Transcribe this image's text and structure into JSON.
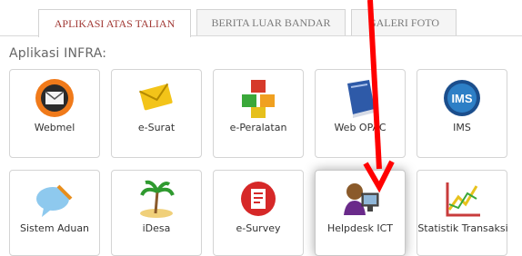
{
  "tabs": [
    {
      "label": "APLIKASI ATAS TALIAN",
      "active": true
    },
    {
      "label": "BERITA LUAR BANDAR",
      "active": false
    },
    {
      "label": "GALERI FOTO",
      "active": false
    }
  ],
  "section_title": "Aplikasi INFRA:",
  "apps": [
    {
      "label": "Webmel",
      "icon": "mail-envelope-icon"
    },
    {
      "label": "e-Surat",
      "icon": "envelope-icon"
    },
    {
      "label": "e-Peralatan",
      "icon": "boxes-icon"
    },
    {
      "label": "Web OPAC",
      "icon": "book-icon"
    },
    {
      "label": "IMS",
      "icon": "ims-globe-icon"
    },
    {
      "label": "Sistem Aduan",
      "icon": "speech-bubble-icon"
    },
    {
      "label": "iDesa",
      "icon": "palm-island-icon"
    },
    {
      "label": "e-Survey",
      "icon": "survey-icon"
    },
    {
      "label": "Helpdesk ICT",
      "icon": "helpdesk-icon"
    },
    {
      "label": "Statistik Transaksi",
      "icon": "chart-icon"
    }
  ],
  "accent_color": "#a23a36",
  "annotation_arrow_color": "#ff0000"
}
